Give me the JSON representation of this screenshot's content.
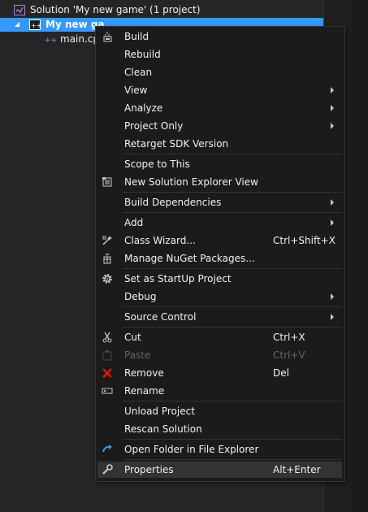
{
  "tree": {
    "solution_label": "Solution 'My new game' (1 project)",
    "project_label": "My new ga",
    "file_label": "main.cp"
  },
  "menu": {
    "build": "Build",
    "rebuild": "Rebuild",
    "clean": "Clean",
    "view": "View",
    "analyze": "Analyze",
    "project_only": "Project Only",
    "retarget": "Retarget SDK Version",
    "scope": "Scope to This",
    "new_view": "New Solution Explorer View",
    "build_deps": "Build Dependencies",
    "add": "Add",
    "class_wizard": "Class Wizard...",
    "class_wizard_sc": "Ctrl+Shift+X",
    "nuget": "Manage NuGet Packages...",
    "startup": "Set as StartUp Project",
    "debug": "Debug",
    "source_control": "Source Control",
    "cut": "Cut",
    "cut_sc": "Ctrl+X",
    "paste": "Paste",
    "paste_sc": "Ctrl+V",
    "remove": "Remove",
    "remove_sc": "Del",
    "rename": "Rename",
    "unload": "Unload Project",
    "rescan": "Rescan Solution",
    "open_folder": "Open Folder in File Explorer",
    "properties": "Properties",
    "properties_sc": "Alt+Enter"
  },
  "icons": {
    "solution": "visual-studio-solution-icon",
    "project": "cpp-project-icon",
    "file": "cpp-file-icon",
    "build": "build-icon",
    "new_view": "new-solution-explorer-view-icon",
    "class_wizard": "class-wizard-icon",
    "nuget": "nuget-icon",
    "startup": "gear-icon",
    "cut": "scissors-icon",
    "paste": "clipboard-icon",
    "remove": "red-x-icon",
    "rename": "rename-icon",
    "open_folder": "refresh-arrow-icon",
    "properties": "wrench-icon"
  },
  "colors": {
    "selection": "#3399ff",
    "menu_bg": "#1b1b1c",
    "highlight": "#333334",
    "remove_red": "#e51400",
    "open_folder_blue": "#3c9ae8"
  }
}
